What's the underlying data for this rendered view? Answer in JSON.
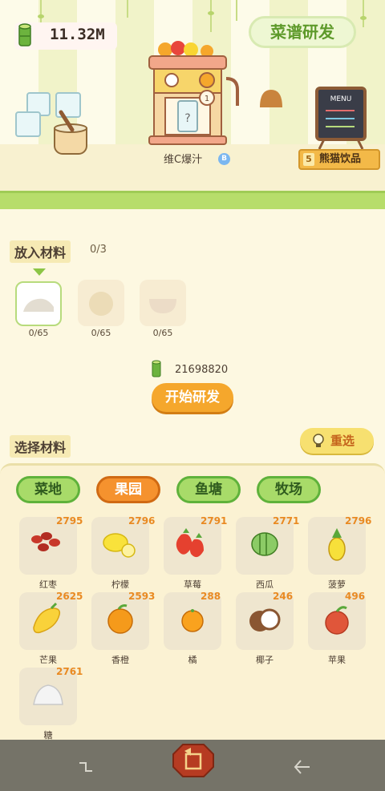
{
  "header": {
    "coin_amount": "11.32M",
    "recipe_button": "菜谱研发"
  },
  "scene": {
    "machine_label": "维C爆汁",
    "machine_badge": "B",
    "panda_drink_button": "熊猫饮品",
    "panda_drink_number": "5",
    "menu_board_title": "MENU",
    "machine_slot_number": "1",
    "cup_mark": "?"
  },
  "ingredients_slot": {
    "title": "放入材料",
    "count": "0/3",
    "slots": [
      {
        "progress": "0/65",
        "icon": "cheese-icon"
      },
      {
        "progress": "0/65",
        "icon": "orange-icon"
      },
      {
        "progress": "0/65",
        "icon": "bowl-icon"
      }
    ]
  },
  "research": {
    "cost": "21698820",
    "start_button": "开始研发"
  },
  "select": {
    "title": "选择材料",
    "reselect_button": "重选",
    "tabs": [
      {
        "label": "菜地",
        "active": false
      },
      {
        "label": "果园",
        "active": true
      },
      {
        "label": "鱼塘",
        "active": false
      },
      {
        "label": "牧场",
        "active": false
      }
    ],
    "items": [
      {
        "name": "红枣",
        "count": "2795",
        "icon": "red-date-icon"
      },
      {
        "name": "柠檬",
        "count": "2796",
        "icon": "lemon-icon"
      },
      {
        "name": "草莓",
        "count": "2791",
        "icon": "strawberry-icon"
      },
      {
        "name": "西瓜",
        "count": "2771",
        "icon": "watermelon-icon"
      },
      {
        "name": "菠萝",
        "count": "2796",
        "icon": "pineapple-icon"
      },
      {
        "name": "芒果",
        "count": "2625",
        "icon": "mango-icon"
      },
      {
        "name": "香橙",
        "count": "2593",
        "icon": "orange-icon"
      },
      {
        "name": "橘",
        "count": "288",
        "icon": "tangerine-icon"
      },
      {
        "name": "椰子",
        "count": "246",
        "icon": "coconut-icon"
      },
      {
        "name": "苹果",
        "count": "496",
        "icon": "apple-icon"
      },
      {
        "name": "糖",
        "count": "2761",
        "icon": "sugar-icon"
      }
    ]
  },
  "colors": {
    "accent_orange": "#f5922e",
    "tab_green": "#a8db69",
    "count_orange": "#e98a22",
    "button_yellow": "#f5a72c"
  }
}
